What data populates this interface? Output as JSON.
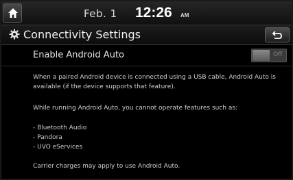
{
  "status_bar": {
    "date": "Feb.  1",
    "time": "12:26",
    "ampm": "AM"
  },
  "title_bar": {
    "title": "Connectivity Settings"
  },
  "setting": {
    "label": "Enable Android Auto",
    "toggle_state": "Off"
  },
  "description": {
    "paragraph1": "When a paired Android device is connected using a USB cable, Android Auto is available (if the device supports that feature).",
    "paragraph2": "While running Android Auto, you cannot operate features such as:",
    "bullets": [
      "- Bluetooth Audio",
      "- Pandora",
      "- UVO eServices"
    ],
    "paragraph3": "Carrier charges may apply to use Android Auto."
  },
  "icons": {
    "home": "home-icon",
    "settings": "gear-icon",
    "back": "back-arrow-icon"
  }
}
